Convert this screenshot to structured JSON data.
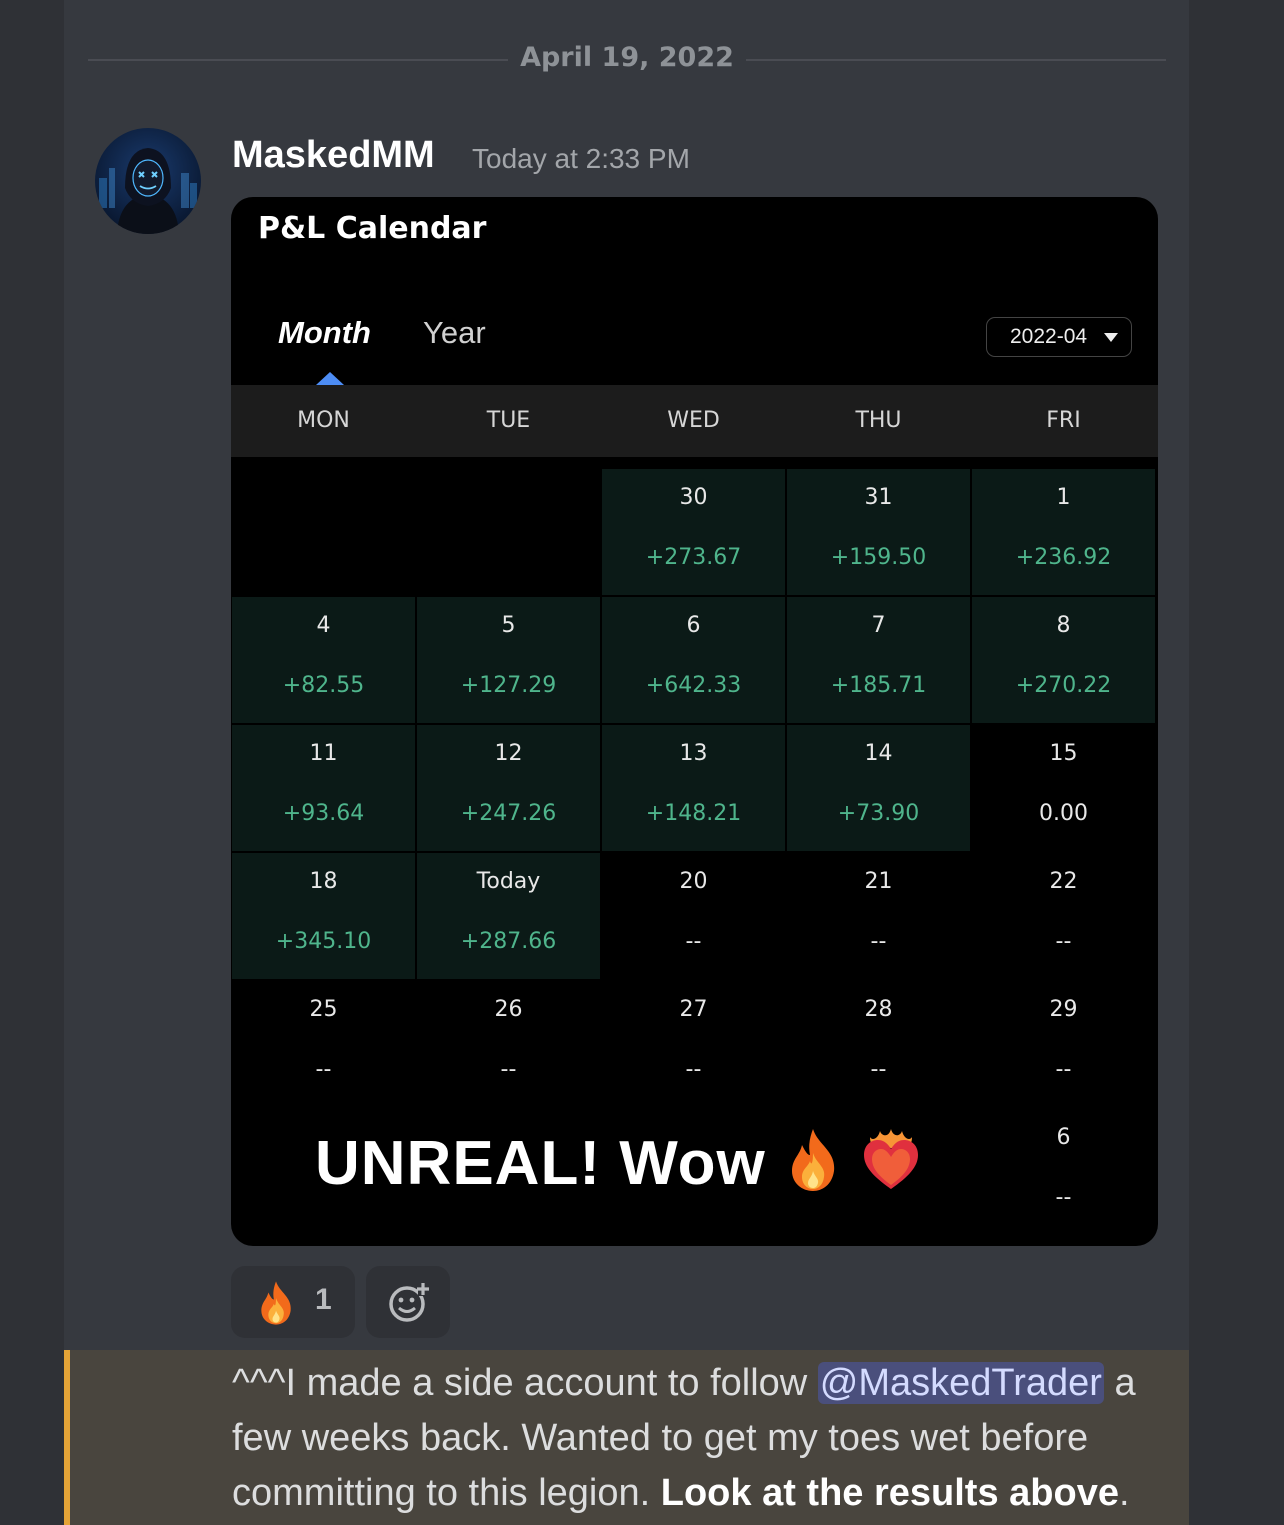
{
  "date_divider": "April 19, 2022",
  "message": {
    "username": "MaskedMM",
    "timestamp": "Today at 2:33 PM"
  },
  "card": {
    "title": "P&L Calendar",
    "tabs": [
      {
        "label": "Month",
        "active": true
      },
      {
        "label": "Year",
        "active": false
      }
    ],
    "month_select": "2022-04",
    "weekdays": [
      "MON",
      "TUE",
      "WED",
      "THU",
      "FRI"
    ],
    "rows": [
      [
        {
          "day": "",
          "pnl": "",
          "status": "hidden"
        },
        {
          "day": "",
          "pnl": "",
          "status": "hidden"
        },
        {
          "day": "30",
          "pnl": "+273.67",
          "status": "profit"
        },
        {
          "day": "31",
          "pnl": "+159.50",
          "status": "profit"
        },
        {
          "day": "1",
          "pnl": "+236.92",
          "status": "profit"
        }
      ],
      [
        {
          "day": "4",
          "pnl": "+82.55",
          "status": "profit"
        },
        {
          "day": "5",
          "pnl": "+127.29",
          "status": "profit"
        },
        {
          "day": "6",
          "pnl": "+642.33",
          "status": "profit"
        },
        {
          "day": "7",
          "pnl": "+185.71",
          "status": "profit"
        },
        {
          "day": "8",
          "pnl": "+270.22",
          "status": "profit"
        }
      ],
      [
        {
          "day": "11",
          "pnl": "+93.64",
          "status": "profit"
        },
        {
          "day": "12",
          "pnl": "+247.26",
          "status": "profit"
        },
        {
          "day": "13",
          "pnl": "+148.21",
          "status": "profit"
        },
        {
          "day": "14",
          "pnl": "+73.90",
          "status": "profit"
        },
        {
          "day": "15",
          "pnl": "0.00",
          "status": "neutral"
        }
      ],
      [
        {
          "day": "18",
          "pnl": "+345.10",
          "status": "profit"
        },
        {
          "day": "Today",
          "pnl": "+287.66",
          "status": "profit"
        },
        {
          "day": "20",
          "pnl": "--",
          "status": "neutral"
        },
        {
          "day": "21",
          "pnl": "--",
          "status": "neutral"
        },
        {
          "day": "22",
          "pnl": "--",
          "status": "neutral"
        }
      ],
      [
        {
          "day": "25",
          "pnl": "--",
          "status": "neutral"
        },
        {
          "day": "26",
          "pnl": "--",
          "status": "neutral"
        },
        {
          "day": "27",
          "pnl": "--",
          "status": "neutral"
        },
        {
          "day": "28",
          "pnl": "--",
          "status": "neutral"
        },
        {
          "day": "29",
          "pnl": "--",
          "status": "neutral"
        }
      ],
      [
        {
          "day": "",
          "pnl": "",
          "status": "hidden"
        },
        {
          "day": "",
          "pnl": "",
          "status": "hidden"
        },
        {
          "day": "",
          "pnl": "",
          "status": "hidden"
        },
        {
          "day": "",
          "pnl": "",
          "status": "hidden"
        },
        {
          "day": "6",
          "pnl": "--",
          "status": "neutral"
        }
      ]
    ],
    "caption": "UNREAL! Wow"
  },
  "reactions": [
    {
      "emoji": "fire-icon",
      "count": "1"
    }
  ],
  "reply": {
    "prefix": "^^^I made a side account to follow ",
    "mention": "@MaskedTrader",
    "middle": " a few weeks back. Wanted to get my toes wet before committing to this legion. ",
    "bold": "Look at the results above",
    "suffix": "."
  },
  "colors": {
    "profit_text": "#4fb58c",
    "profit_bg": "#0b1a17",
    "highlight_bar": "#e5a437",
    "mention_bg": "#4a4f7c",
    "tab_indicator": "#4d8df5"
  }
}
